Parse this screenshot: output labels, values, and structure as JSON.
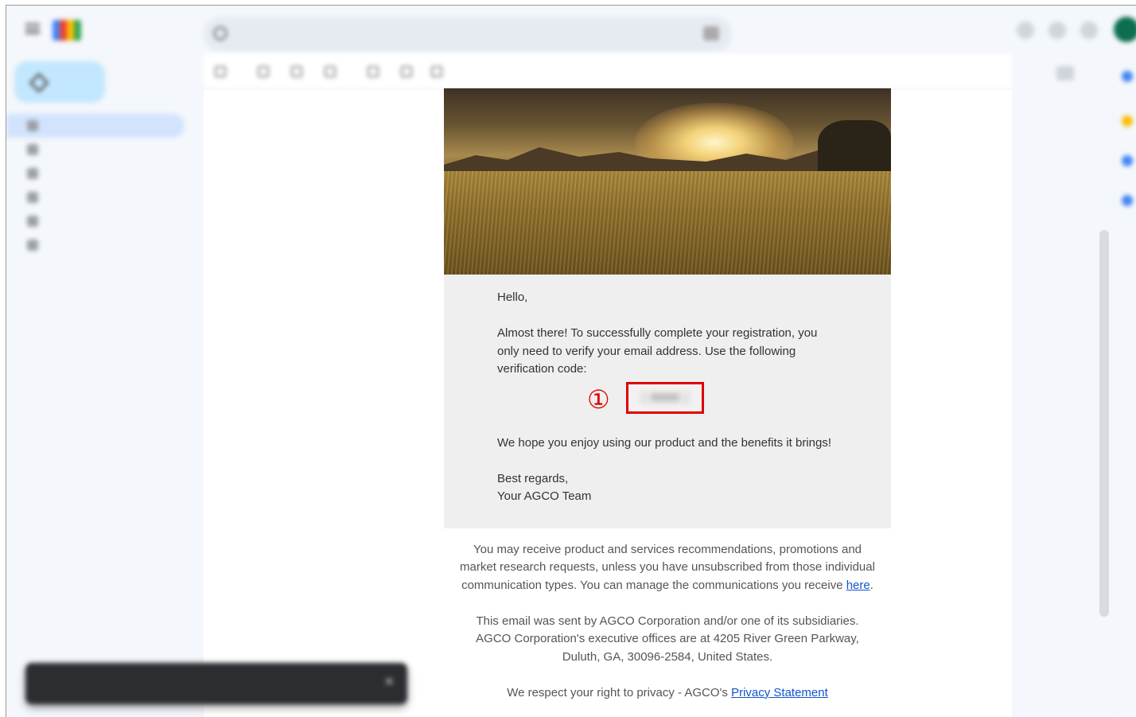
{
  "email": {
    "greeting": "Hello,",
    "intro": "Almost there! To successfully complete your registration, you only need to verify your email address. Use the following verification code:",
    "code_marker": "①",
    "closing_line": "We hope you enjoy using our product and the benefits it brings!",
    "sign_off": "Best regards,",
    "signature": "Your AGCO Team"
  },
  "footer": {
    "marketing_text": "You may receive product and services recommendations, promotions and market research requests, unless you have unsubscribed from those individual communication types. You can manage the communications you receive",
    "here_link": "here",
    "period": ".",
    "sender_line1": "This email was sent by AGCO Corporation and/or one of its subsidiaries.",
    "sender_line2": "AGCO Corporation's executive offices are at 4205 River Green Parkway,",
    "sender_line3": "Duluth, GA, 30096-2584, United States.",
    "privacy_text": "We respect your right to privacy - AGCO's",
    "privacy_link": "Privacy Statement"
  },
  "colors": {
    "highlight": "#e00000",
    "link": "#1155cc",
    "card_bg": "#efefef",
    "app_bg": "#f4f7fb"
  },
  "icons": [
    "menu-icon",
    "search-icon",
    "filter-icon",
    "compose-icon",
    "close-icon"
  ]
}
